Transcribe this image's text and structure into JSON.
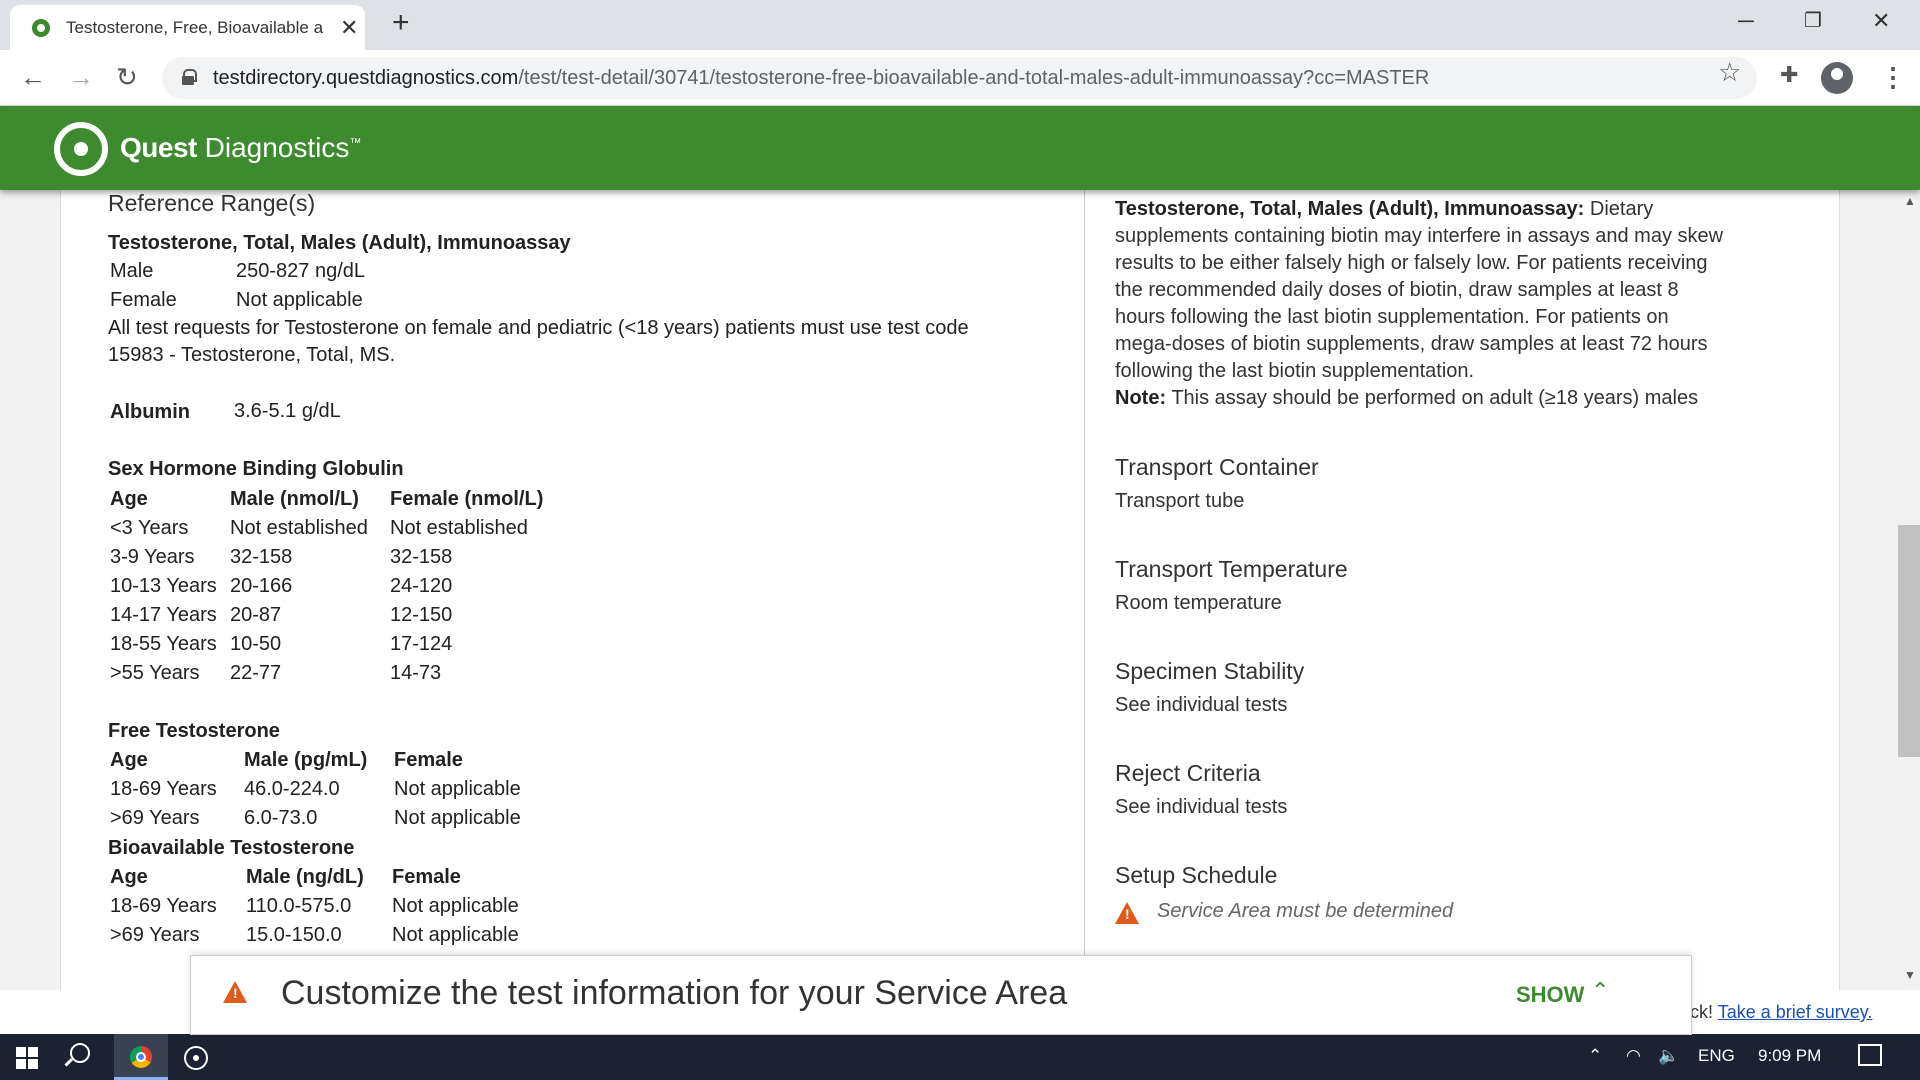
{
  "browser": {
    "tab_title": "Testosterone, Free, Bioavailable a",
    "url_domain": "testdirectory.questdiagnostics.com",
    "url_path": "/test/test-detail/30741/testosterone-free-bioavailable-and-total-males-adult-immunoassay?cc=MASTER"
  },
  "header": {
    "brand_bold": "Quest",
    "brand_light": "Diagnostics",
    "tm": "™"
  },
  "left": {
    "ref_title": "Reference Range(s)",
    "tt_heading": "Testosterone, Total, Males (Adult), Immunoassay",
    "tt_rows": [
      {
        "label": "Male",
        "value": "250-827 ng/dL"
      },
      {
        "label": "Female",
        "value": "Not applicable"
      }
    ],
    "tt_note_line1": "All test requests for Testosterone on female and pediatric (<18 years) patients must use test code",
    "tt_note_line2": "15983 - Testosterone, Total, MS.",
    "albumin_label": "Albumin",
    "albumin_value": "3.6-5.1 g/dL",
    "shbg_heading": "Sex Hormone Binding Globulin",
    "shbg_headers": [
      "Age",
      "Male (nmol/L)",
      "Female (nmol/L)"
    ],
    "shbg_rows": [
      [
        "<3 Years",
        "Not established",
        "Not established"
      ],
      [
        "3-9 Years",
        "32-158",
        "32-158"
      ],
      [
        "10-13 Years",
        "20-166",
        "24-120"
      ],
      [
        "14-17 Years",
        "20-87",
        "12-150"
      ],
      [
        "18-55 Years",
        "10-50",
        "17-124"
      ],
      [
        ">55 Years",
        "22-77",
        "14-73"
      ]
    ],
    "ft_heading": "Free Testosterone",
    "ft_headers": [
      "Age",
      "Male (pg/mL)",
      "Female"
    ],
    "ft_rows": [
      [
        "18-69 Years",
        "46.0-224.0",
        "Not applicable"
      ],
      [
        ">69 Years",
        "6.0-73.0",
        "Not applicable"
      ]
    ],
    "bt_heading": "Bioavailable Testosterone",
    "bt_headers": [
      "Age",
      "Male (ng/dL)",
      "Female"
    ],
    "bt_rows": [
      [
        "18-69 Years",
        "110.0-575.0",
        "Not applicable"
      ],
      [
        ">69 Years",
        "15.0-150.0",
        "Not applicable"
      ]
    ]
  },
  "right": {
    "biotin_bold": "Testosterone, Total, Males (Adult), Immunoassay:",
    "biotin_lines": [
      "Dietary",
      "supplements containing biotin may interfere in assays and may skew",
      "results to be either falsely high or falsely low. For patients receiving",
      "the recommended daily doses of biotin, draw samples at least 8",
      "hours following the last biotin supplementation. For patients on",
      "mega-doses of biotin supplements, draw samples at least 72 hours",
      "following the last biotin supplementation."
    ],
    "note_bold": "Note:",
    "note_text": "This assay should be performed on adult (≥18 years) males",
    "sections": [
      {
        "title": "Transport Container",
        "value": "Transport tube"
      },
      {
        "title": "Transport Temperature",
        "value": "Room temperature"
      },
      {
        "title": "Specimen Stability",
        "value": "See individual tests"
      },
      {
        "title": "Reject Criteria",
        "value": "See individual tests"
      }
    ],
    "setup_title": "Setup Schedule",
    "setup_value": "Service Area must be determined"
  },
  "banner": {
    "text": "Customize the test information for your Service Area",
    "show_label": "SHOW"
  },
  "survey": {
    "prefix": "ck!",
    "link": "Take a brief survey."
  },
  "taskbar": {
    "lang": "ENG",
    "time": "9:09 PM"
  }
}
